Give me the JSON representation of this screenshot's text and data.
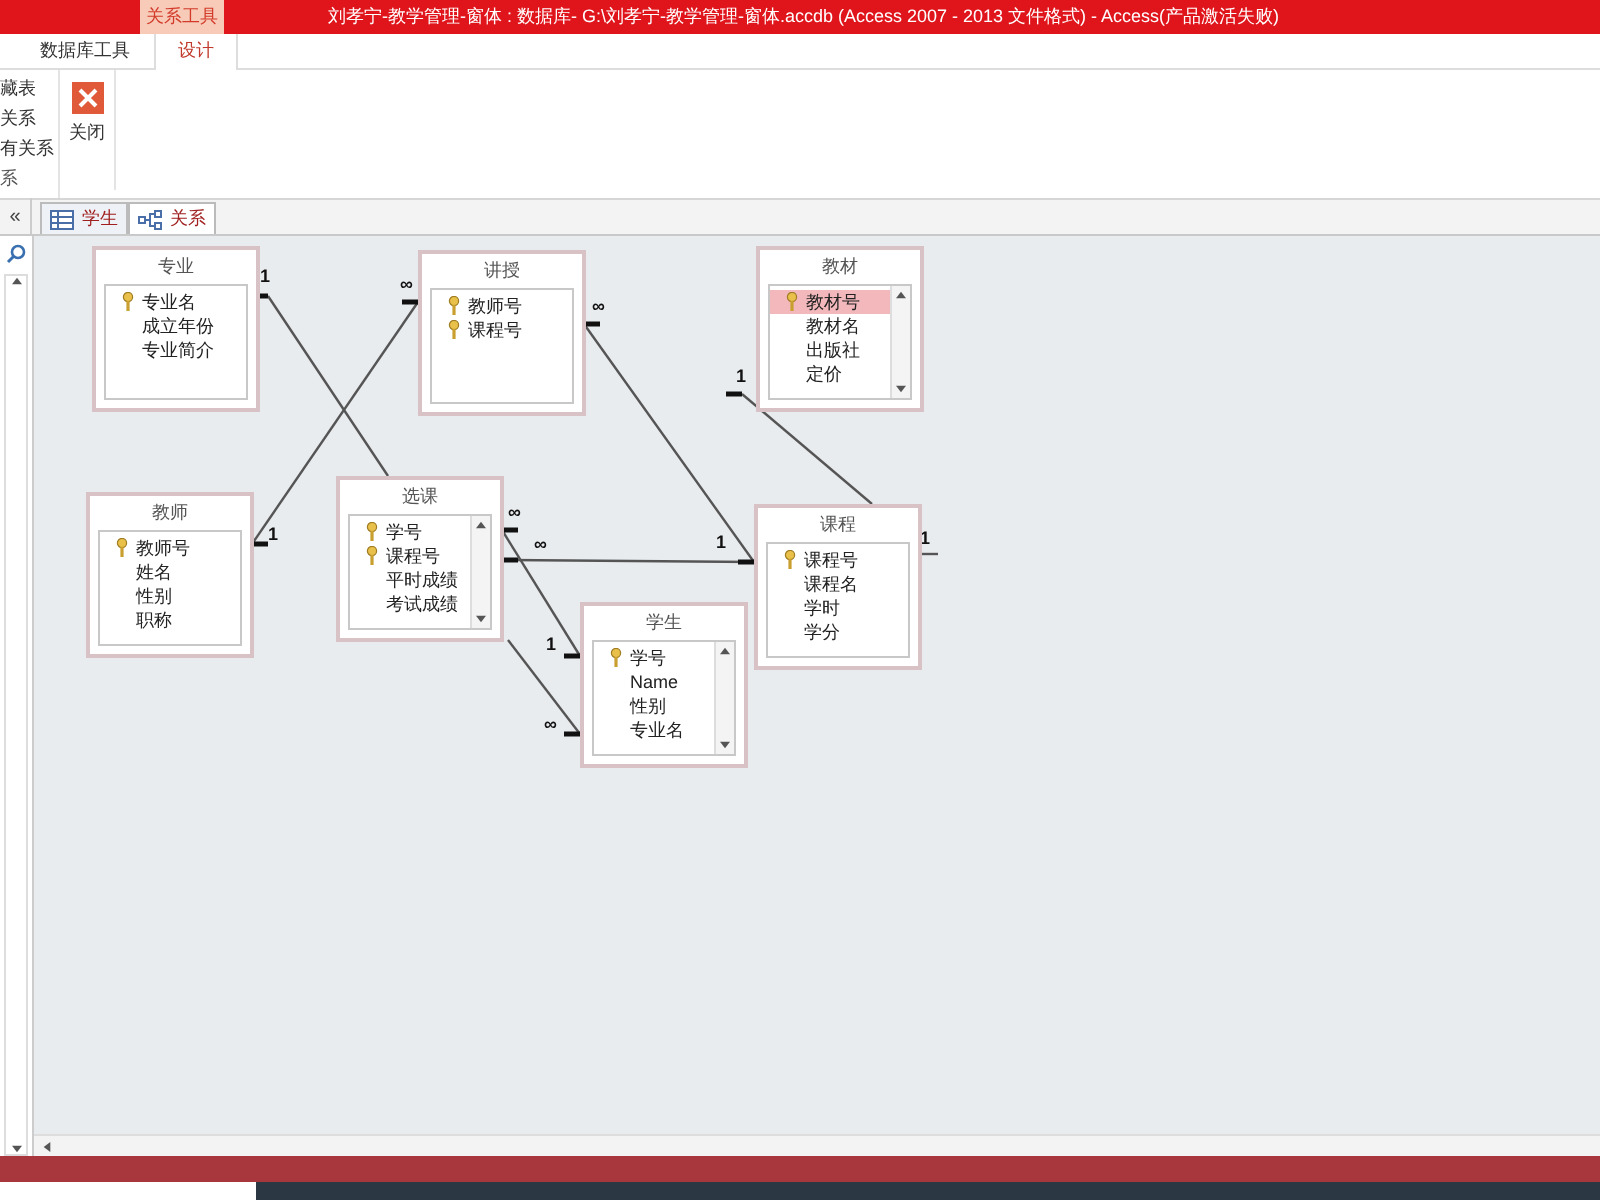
{
  "window": {
    "title": "刘孝宁-教学管理-窗体 : 数据库- G:\\刘孝宁-教学管理-窗体.accdb (Access 2007 - 2013 文件格式) -  Access(产品激活失败)",
    "context_tab": "关系工具"
  },
  "ribbon_tabs": [
    {
      "label": "数据库工具",
      "selected": false
    },
    {
      "label": "设计",
      "selected": true
    }
  ],
  "ribbon_items": [
    "藏表",
    "关系",
    "有关系"
  ],
  "ribbon_group": "系",
  "close_button": {
    "label": "关闭"
  },
  "nav_toggle": "«",
  "doc_tabs": [
    {
      "label": "学生",
      "kind": "table",
      "selected": false
    },
    {
      "label": "关系",
      "kind": "relationships",
      "selected": true
    }
  ],
  "tables": [
    {
      "title": "专业",
      "scroll": false,
      "fields": [
        {
          "name": "专业名",
          "key": true,
          "selected": false
        },
        {
          "name": "成立年份",
          "key": false,
          "selected": false
        },
        {
          "name": "专业简介",
          "key": false,
          "selected": false
        }
      ]
    },
    {
      "title": "讲授",
      "scroll": false,
      "fields": [
        {
          "name": "教师号",
          "key": true,
          "selected": false
        },
        {
          "name": "课程号",
          "key": true,
          "selected": false
        }
      ]
    },
    {
      "title": "教材",
      "scroll": true,
      "fields": [
        {
          "name": "教材号",
          "key": true,
          "selected": true
        },
        {
          "name": "教材名",
          "key": false,
          "selected": false
        },
        {
          "name": "出版社",
          "key": false,
          "selected": false
        },
        {
          "name": "定价",
          "key": false,
          "selected": false
        }
      ]
    },
    {
      "title": "教师",
      "scroll": false,
      "fields": [
        {
          "name": "教师号",
          "key": true,
          "selected": false
        },
        {
          "name": "姓名",
          "key": false,
          "selected": false
        },
        {
          "name": "性别",
          "key": false,
          "selected": false
        },
        {
          "name": "职称",
          "key": false,
          "selected": false
        }
      ]
    },
    {
      "title": "选课",
      "scroll": true,
      "fields": [
        {
          "name": "学号",
          "key": true,
          "selected": false
        },
        {
          "name": "课程号",
          "key": true,
          "selected": false
        },
        {
          "name": "平时成绩",
          "key": false,
          "selected": false
        },
        {
          "name": "考试成绩",
          "key": false,
          "selected": false
        }
      ]
    },
    {
      "title": "课程",
      "scroll": false,
      "fields": [
        {
          "name": "课程号",
          "key": true,
          "selected": false
        },
        {
          "name": "课程名",
          "key": false,
          "selected": false
        },
        {
          "name": "学时",
          "key": false,
          "selected": false
        },
        {
          "name": "学分",
          "key": false,
          "selected": false
        }
      ]
    },
    {
      "title": "学生",
      "scroll": true,
      "fields": [
        {
          "name": "学号",
          "key": true,
          "selected": false
        },
        {
          "name": "Name",
          "key": false,
          "selected": false
        },
        {
          "name": "性别",
          "key": false,
          "selected": false
        },
        {
          "name": "专业名",
          "key": false,
          "selected": false
        }
      ]
    }
  ],
  "relationships": [
    {
      "from_mark": "1"
    },
    {
      "from_mark": "1",
      "to_mark": "∞"
    },
    {
      "from_mark": "∞"
    },
    {
      "from_mark": "∞",
      "to_mark": "1"
    },
    {
      "from_mark": "∞",
      "to_mark": "1"
    },
    {
      "to_mark": "∞"
    },
    {
      "from_mark": "1"
    },
    {
      "from_mark": "1"
    }
  ]
}
